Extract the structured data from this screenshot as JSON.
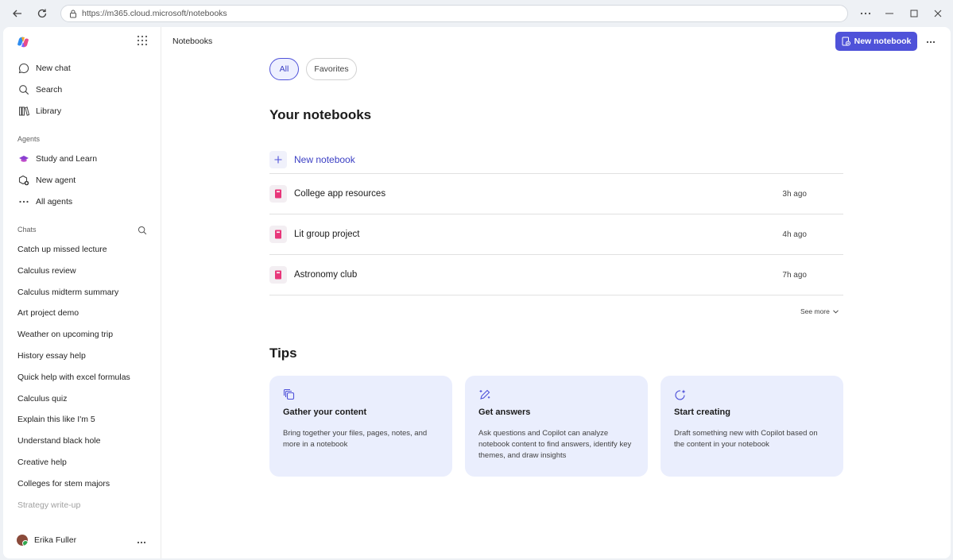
{
  "browser": {
    "url": "https://m365.cloud.microsoft/notebooks"
  },
  "sidebar": {
    "nav": [
      {
        "label": "New chat",
        "icon": "chat-bubble-icon"
      },
      {
        "label": "Search",
        "icon": "search-icon"
      },
      {
        "label": "Library",
        "icon": "library-icon"
      }
    ],
    "agents_label": "Agents",
    "agents": [
      {
        "label": "Study and Learn",
        "icon": "graduation-cap-icon"
      },
      {
        "label": "New agent",
        "icon": "add-agent-icon"
      },
      {
        "label": "All agents",
        "icon": "more-dots-icon"
      }
    ],
    "chats_label": "Chats",
    "chats": [
      "Catch up missed lecture",
      "Calculus review",
      "Calculus midterm summary",
      "Art project demo",
      "Weather on upcoming trip",
      "History essay help",
      "Quick help with excel formulas",
      "Calculus quiz",
      "Explain this like I'm 5",
      "Understand black hole",
      "Creative help",
      "Colleges for stem majors",
      "Strategy write-up"
    ],
    "user": {
      "name": "Erika Fuller"
    }
  },
  "header": {
    "breadcrumb": "Notebooks",
    "new_notebook_button": "New notebook"
  },
  "filters": {
    "all": "All",
    "favorites": "Favorites"
  },
  "notebooks": {
    "heading": "Your notebooks",
    "new_label": "New notebook",
    "items": [
      {
        "title": "College app resources",
        "time": "3h ago"
      },
      {
        "title": "Lit group project",
        "time": "4h ago"
      },
      {
        "title": "Astronomy club",
        "time": "7h ago"
      }
    ],
    "see_more": "See more"
  },
  "tips": {
    "heading": "Tips",
    "cards": [
      {
        "title": "Gather your content",
        "desc": "Bring together your files, pages, notes, and more in a notebook",
        "icon": "stack-icon"
      },
      {
        "title": "Get answers",
        "desc": "Ask questions and Copilot can analyze notebook content to find answers, identify key themes, and draw insights",
        "icon": "pen-sparkle-icon"
      },
      {
        "title": "Start creating",
        "desc": "Draft something new with Copilot based on the content in your notebook",
        "icon": "sparkle-loop-icon"
      }
    ]
  },
  "colors": {
    "accent": "#4f52d9",
    "tip_card_bg": "#eaeefd",
    "notebook_icon": "#e8367a"
  }
}
